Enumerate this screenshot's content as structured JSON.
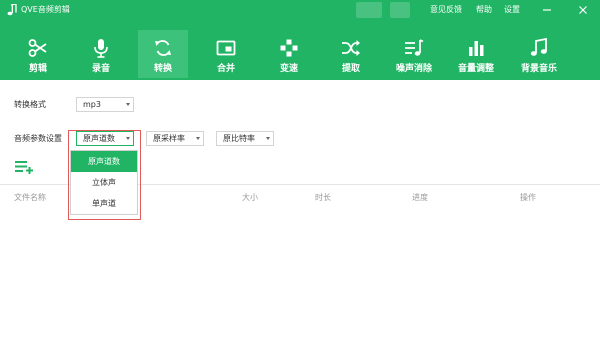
{
  "app": {
    "title": "QVE音频剪辑"
  },
  "titlebar": {
    "links": [
      "意见反馈",
      "帮助",
      "设置"
    ]
  },
  "toolbar": {
    "items": [
      {
        "label": "剪辑",
        "icon": "scissors-icon"
      },
      {
        "label": "录音",
        "icon": "microphone-icon"
      },
      {
        "label": "转换",
        "icon": "convert-icon"
      },
      {
        "label": "合并",
        "icon": "merge-icon"
      },
      {
        "label": "变速",
        "icon": "speed-icon"
      },
      {
        "label": "提取",
        "icon": "shuffle-icon"
      },
      {
        "label": "噪声消除",
        "icon": "noise-icon"
      },
      {
        "label": "音量调整",
        "icon": "volume-bars-icon"
      },
      {
        "label": "背景音乐",
        "icon": "music-note-icon"
      }
    ],
    "active_index": 2
  },
  "format": {
    "label": "转换格式",
    "value": "mp3"
  },
  "params": {
    "label": "音频参数设置",
    "channels": "原声道数",
    "sample_rate": "原采样率",
    "bit_rate": "原比特率"
  },
  "dropdown": {
    "options": [
      "原声道数",
      "立体声",
      "单声道"
    ],
    "selected_index": 0
  },
  "table": {
    "columns": [
      "文件名称",
      "大小",
      "时长",
      "进度",
      "操作"
    ]
  },
  "colors": {
    "brand": "#21b464",
    "highlight": "#e05a5a"
  }
}
